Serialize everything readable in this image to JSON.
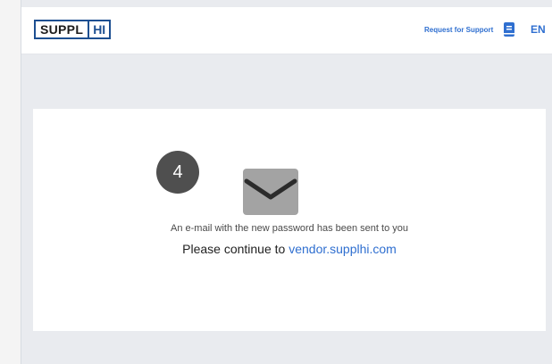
{
  "header": {
    "logo": {
      "part1": "SUPPL",
      "part2": "HI"
    },
    "support_link": "Request for Support",
    "language": "EN",
    "icons": {
      "manual": "book-icon"
    }
  },
  "main": {
    "step_number": "4",
    "icon": "mail-icon",
    "message": "An e-mail with the new password has been sent to you",
    "continue_prefix": "Please continue to",
    "continue_link": "vendor.supplhi.com"
  },
  "colors": {
    "brand": "#1d4f91",
    "link": "#2f6fd0",
    "badge": "#4f4f4f",
    "icon": "#a3a3a3"
  }
}
